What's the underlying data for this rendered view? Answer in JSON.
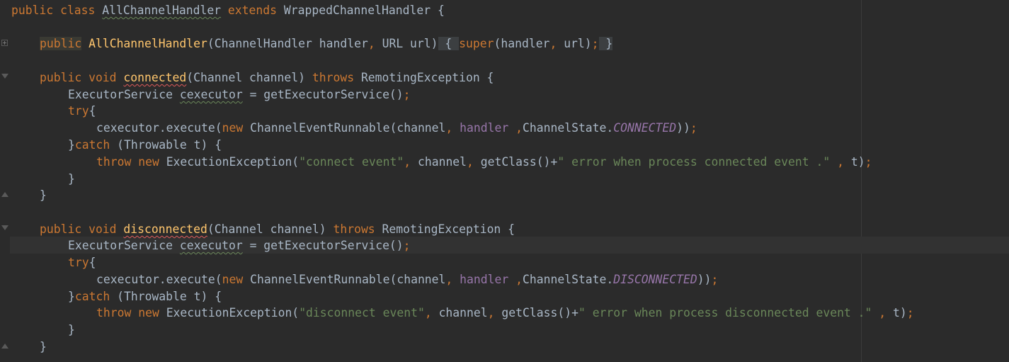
{
  "editor": {
    "language": "java",
    "colors": {
      "background": "#2b2b2b",
      "keyword": "#cc7832",
      "method": "#ffc66d",
      "string": "#6a8759",
      "field": "#9876aa",
      "text": "#a9b7c6"
    },
    "lines": {
      "l1": {
        "a": "public class ",
        "b": "AllChannelHandler",
        "c": " extends ",
        "d": "WrappedChannelHandler {"
      },
      "l3": {
        "a": "public",
        "b": " ",
        "c": "AllChannelHandler",
        "d": "(ChannelHandler handler",
        "e": ", ",
        "f": "URL url)",
        "g": " { ",
        "h": "super",
        "i": "(handler",
        "j": ", ",
        "k": "url)",
        "l": ";",
        "m": " }"
      },
      "l5": {
        "a": "public void ",
        "b": "connected",
        "c": "(Channel channel) ",
        "d": "throws ",
        "e": "RemotingException {"
      },
      "l6": {
        "a": "ExecutorService ",
        "b": "cexecutor",
        "c": " = getExecutorService()",
        "d": ";"
      },
      "l7": {
        "a": "try",
        "b": "{"
      },
      "l8": {
        "a": "cexecutor.execute(",
        "b": "new ",
        "c": "ChannelEventRunnable(channel",
        "d": ", ",
        "e": "handler",
        "f": " ,",
        "g": "ChannelState.",
        "h": "CONNECTED",
        "i": "))",
        "j": ";"
      },
      "l9": {
        "a": "}",
        "b": "catch ",
        "c": "(Throwable t) {"
      },
      "l10": {
        "a": "throw new ",
        "b": "ExecutionException(",
        "c": "\"connect event\"",
        "d": ", ",
        "e": "channel",
        "f": ", ",
        "g": "getClass()+",
        "h": "\" error when process connected event .\"",
        "i": " , ",
        "j": "t)",
        "k": ";"
      },
      "l11": {
        "a": "}"
      },
      "l12": {
        "a": "}"
      },
      "l14": {
        "a": "public void ",
        "b": "disconnected",
        "c": "(Channel channel) ",
        "d": "throws ",
        "e": "RemotingException {"
      },
      "l15": {
        "a": "ExecutorService ",
        "b": "cexecutor",
        "c": " = getExecutorService()",
        "d": ";"
      },
      "l16": {
        "a": "try",
        "b": "{"
      },
      "l17": {
        "a": "cexecutor.execute(",
        "b": "new ",
        "c": "ChannelEventRunnable(channel",
        "d": ", ",
        "e": "handler",
        "f": " ,",
        "g": "ChannelState.",
        "h": "DISCONNECTED",
        "i": "))",
        "j": ";"
      },
      "l18": {
        "a": "}",
        "b": "catch ",
        "c": "(Throwable t) {"
      },
      "l19": {
        "a": "throw new ",
        "b": "ExecutionException(",
        "c": "\"disconnect event\"",
        "d": ", ",
        "e": "channel",
        "f": ", ",
        "g": "getClass()+",
        "h": "\" error when process disconnected event .\"",
        "i": " , ",
        "j": "t)",
        "k": ";"
      },
      "l20": {
        "a": "}"
      },
      "l21": {
        "a": "}"
      }
    }
  }
}
